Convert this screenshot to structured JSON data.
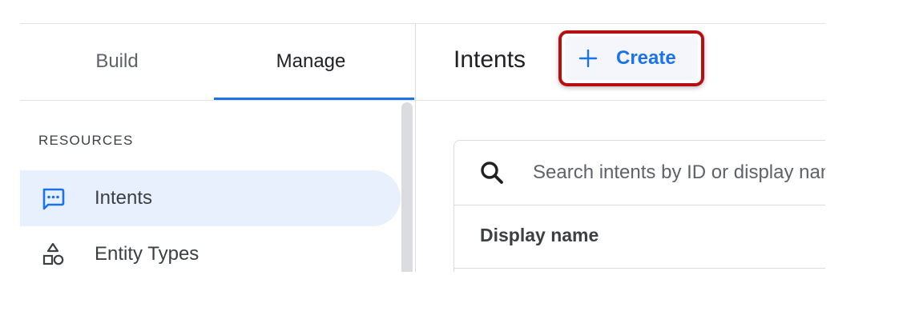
{
  "tabs": [
    {
      "label": "Build",
      "active": false
    },
    {
      "label": "Manage",
      "active": true
    }
  ],
  "sidebar": {
    "section_heading": "RESOURCES",
    "items": [
      {
        "label": "Intents",
        "icon": "intents-icon",
        "active": true
      },
      {
        "label": "Entity Types",
        "icon": "entity-types-icon",
        "active": false
      }
    ]
  },
  "header": {
    "title": "Intents",
    "create_label": "Create",
    "create_icon": "plus-icon"
  },
  "search": {
    "placeholder": "Search intents by ID or display name",
    "value": ""
  },
  "table": {
    "columns": [
      "Display name"
    ]
  },
  "colors": {
    "accent": "#1a73e8",
    "active_nav_bg": "#e8f0fe",
    "highlight_border": "#b80d11"
  }
}
